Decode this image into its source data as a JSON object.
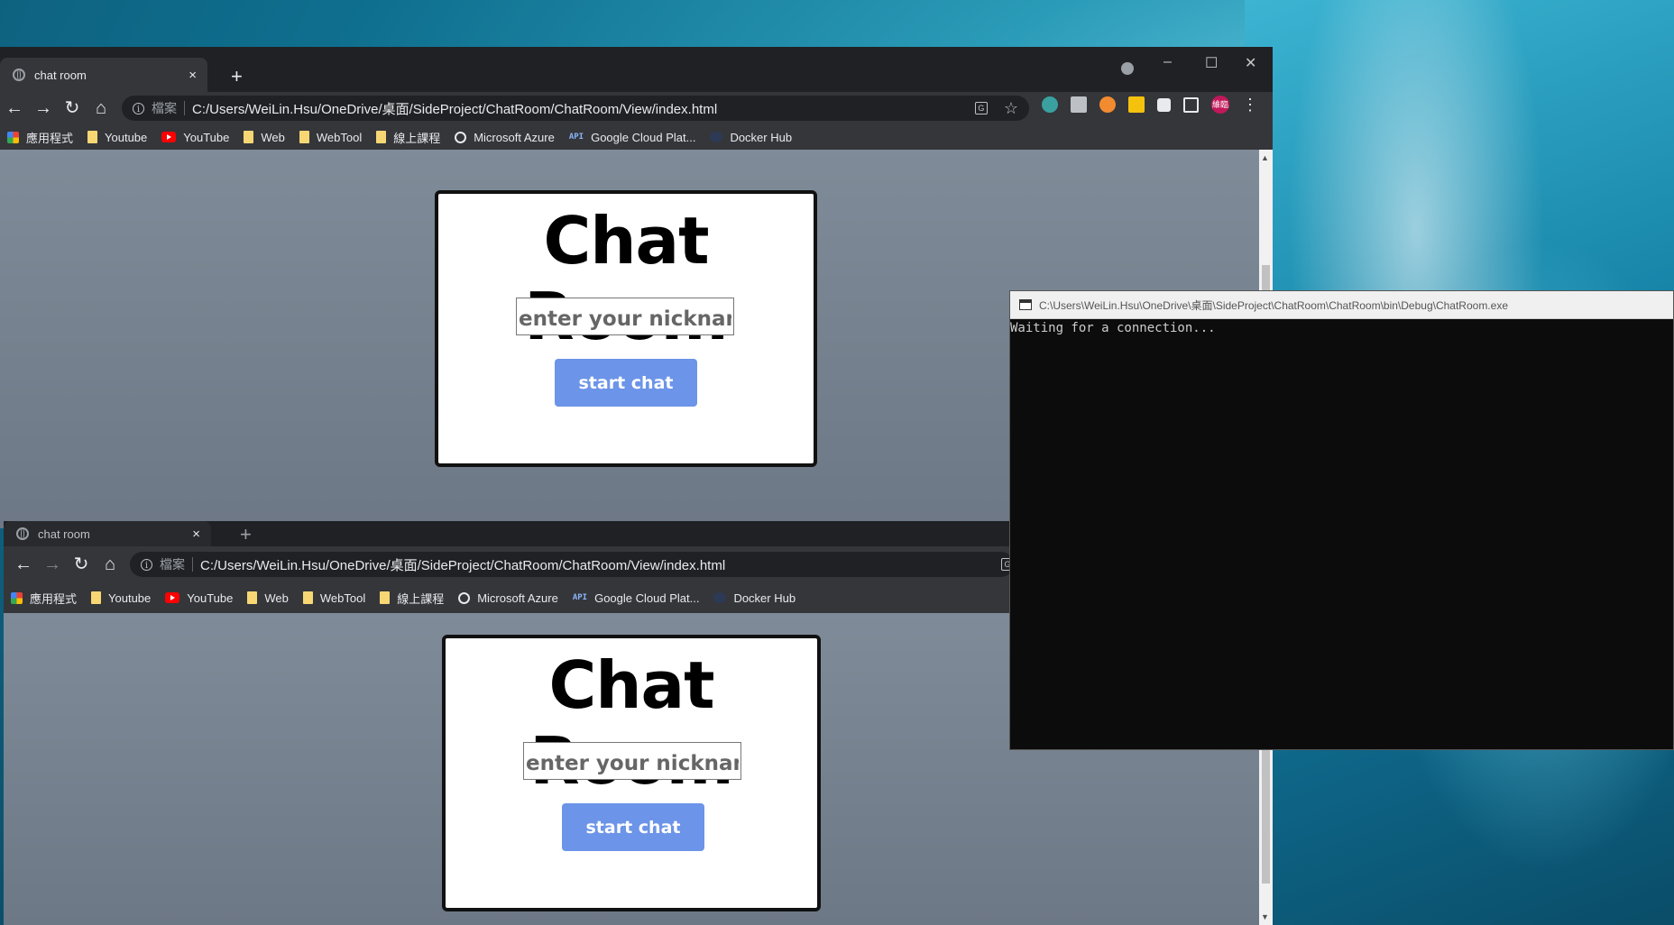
{
  "browser_top": {
    "tab_title": "chat room",
    "tab_close": "×",
    "new_tab": "+",
    "origin_label": "檔案",
    "url": "C:/Users/WeiLin.Hsu/OneDrive/桌面/SideProject/ChatRoom/ChatRoom/View/index.html",
    "profile_label": "維臨",
    "window_controls": {
      "minimize": "–",
      "maximize": "☐",
      "close": "✕"
    }
  },
  "browser_bottom": {
    "tab_title": "chat room",
    "tab_close": "×",
    "new_tab": "+",
    "origin_label": "檔案",
    "url": "C:/Users/WeiLin.Hsu/OneDrive/桌面/SideProject/ChatRoom/ChatRoom/View/index.html"
  },
  "nav": {
    "back": "←",
    "forward": "→",
    "reload": "↻",
    "home": "⌂",
    "info": "i",
    "star": "☆",
    "menu": "⋮"
  },
  "bookmarks": [
    {
      "label": "應用程式",
      "icon": "apps-icon"
    },
    {
      "label": "Youtube",
      "icon": "folder-icon"
    },
    {
      "label": "YouTube",
      "icon": "youtube-icon"
    },
    {
      "label": "Web",
      "icon": "folder-icon"
    },
    {
      "label": "WebTool",
      "icon": "folder-icon"
    },
    {
      "label": "線上課程",
      "icon": "folder-icon"
    },
    {
      "label": "Microsoft Azure",
      "icon": "globe-icon"
    },
    {
      "label": "Google Cloud Plat...",
      "icon": "api-icon"
    },
    {
      "label": "Docker Hub",
      "icon": "docker-icon"
    }
  ],
  "page": {
    "title": "Chat Room",
    "nickname_placeholder": "enter your nickname",
    "start_button": "start chat"
  },
  "console": {
    "title": "C:\\Users\\WeiLin.Hsu\\OneDrive\\桌面\\SideProject\\ChatRoom\\ChatRoom\\bin\\Debug\\ChatRoom.exe",
    "output": "Waiting for a connection..."
  },
  "colors": {
    "button_bg": "#6c94e8",
    "page_bg": "#7f8b98",
    "chrome_dark": "#202124",
    "chrome_toolbar": "#35363a",
    "console_bg": "#0c0c0c"
  }
}
